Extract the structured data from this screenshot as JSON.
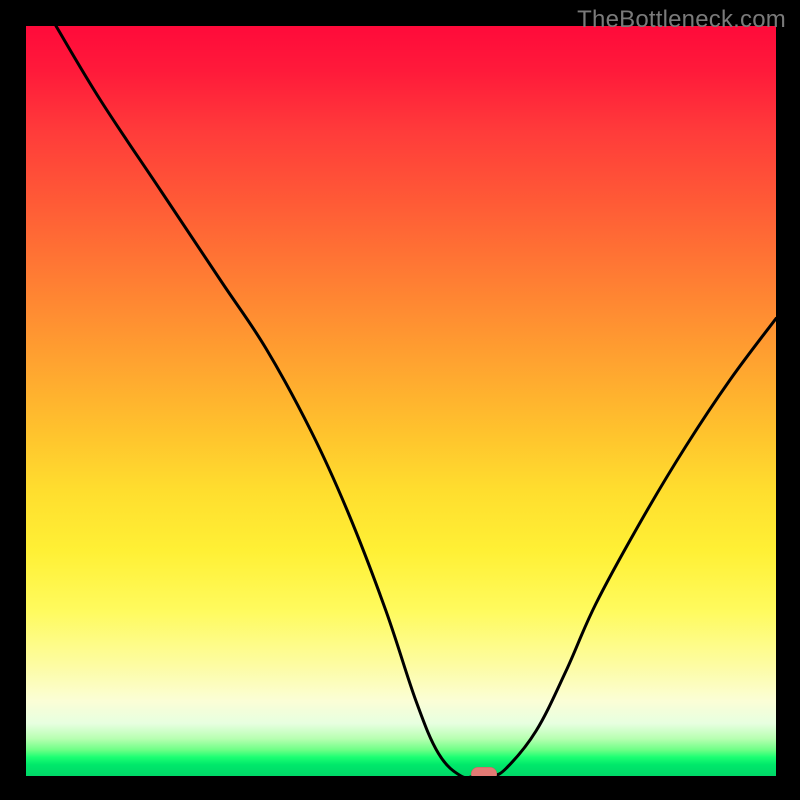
{
  "watermark": "TheBottleneck.com",
  "chart_data": {
    "type": "line",
    "title": "",
    "xlabel": "",
    "ylabel": "",
    "xlim": [
      0,
      100
    ],
    "ylim": [
      0,
      100
    ],
    "grid": false,
    "legend": false,
    "series": [
      {
        "name": "bottleneck-curve",
        "x": [
          4,
          10,
          18,
          26,
          32,
          38,
          43,
          48,
          52,
          55,
          58,
          60,
          62,
          64,
          68,
          72,
          76,
          82,
          88,
          94,
          100
        ],
        "y": [
          100,
          90,
          78,
          66,
          57,
          46,
          35,
          22,
          10,
          3,
          0,
          0,
          0,
          1,
          6,
          14,
          23,
          34,
          44,
          53,
          61
        ]
      }
    ],
    "marker": {
      "x": 61,
      "y": 0,
      "color": "#e27a74"
    },
    "background": "vertical-rainbow-red-to-green"
  },
  "colors": {
    "curve": "#000000",
    "marker": "#e27a74",
    "frame": "#000000",
    "watermark": "#7a7a7a"
  }
}
